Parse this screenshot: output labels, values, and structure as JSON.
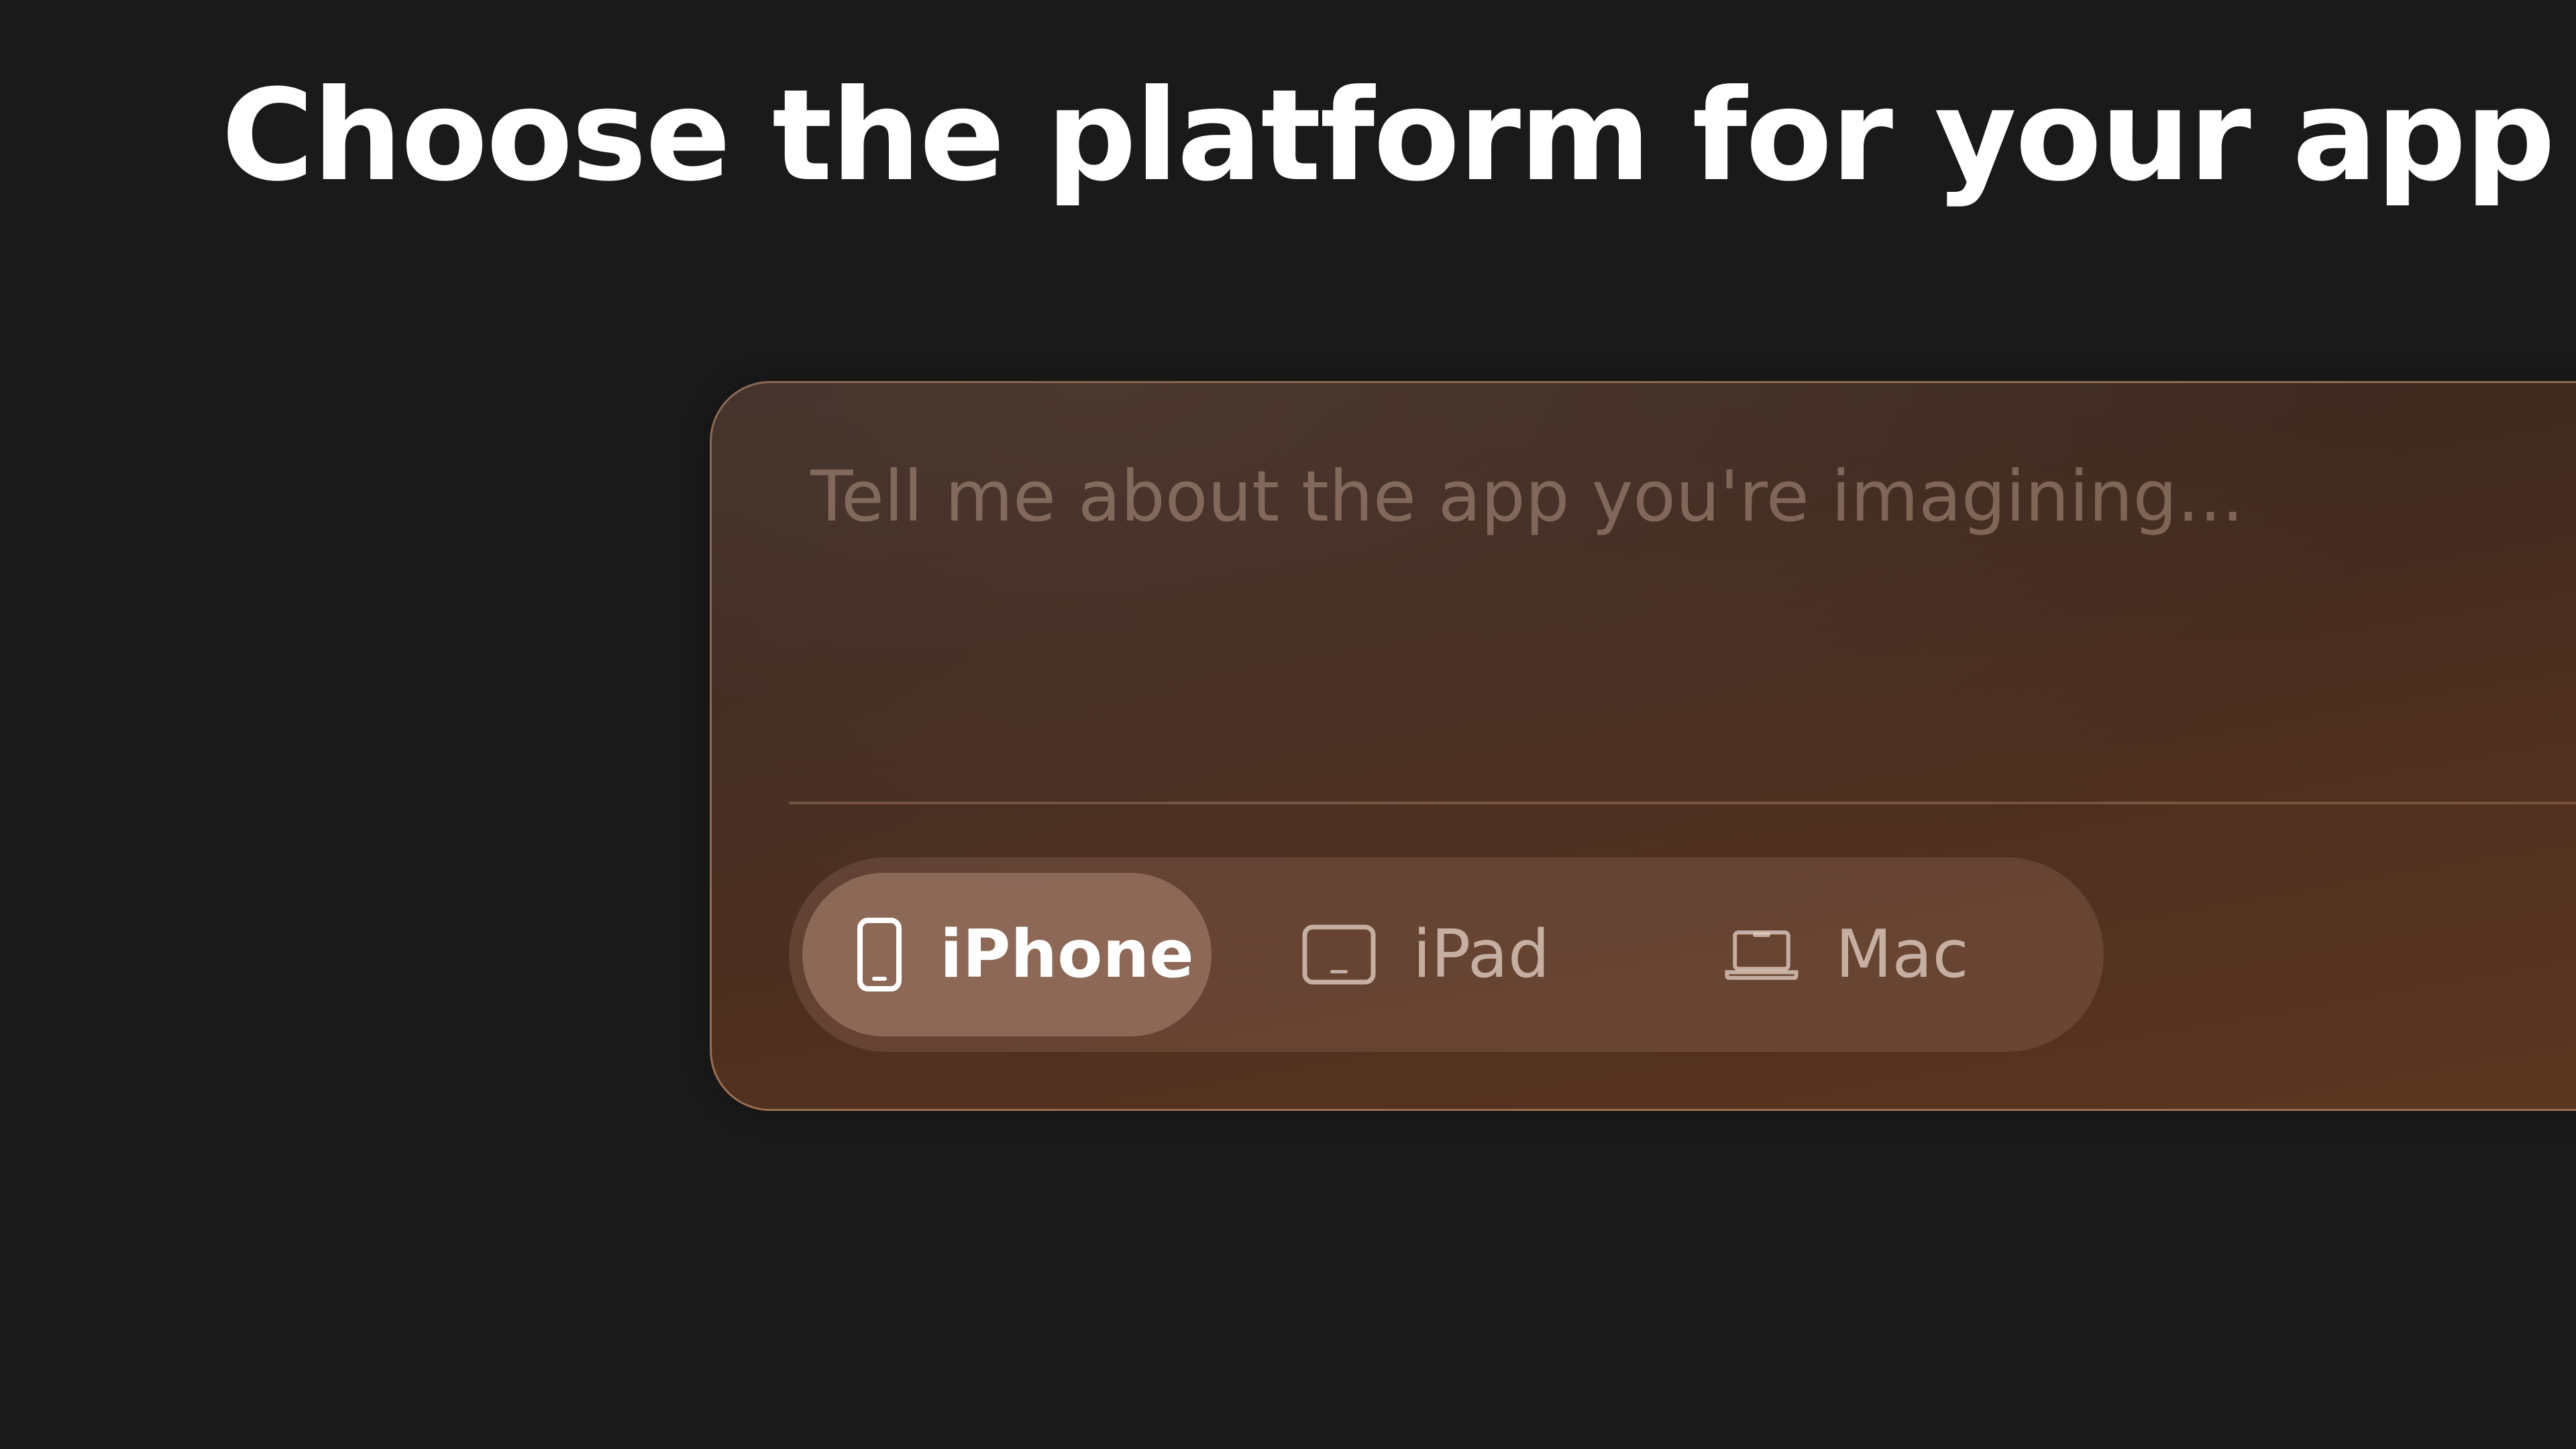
{
  "headline": "Choose the platform for your app",
  "composer": {
    "placeholder": "Tell me about the app you're imagining..."
  },
  "platforms": {
    "selected": "iPhone",
    "options": [
      {
        "label": "iPhone",
        "icon": "iphone-icon"
      },
      {
        "label": "iPad",
        "icon": "ipad-icon"
      },
      {
        "label": "Mac",
        "icon": "macbook-icon"
      }
    ]
  },
  "colors": {
    "background": "#1a1a1a",
    "headline": "#ffffff",
    "composer_gradient_start": "#3a2c26",
    "composer_gradient_end": "#5c3620",
    "composer_border": "#d6a078"
  }
}
